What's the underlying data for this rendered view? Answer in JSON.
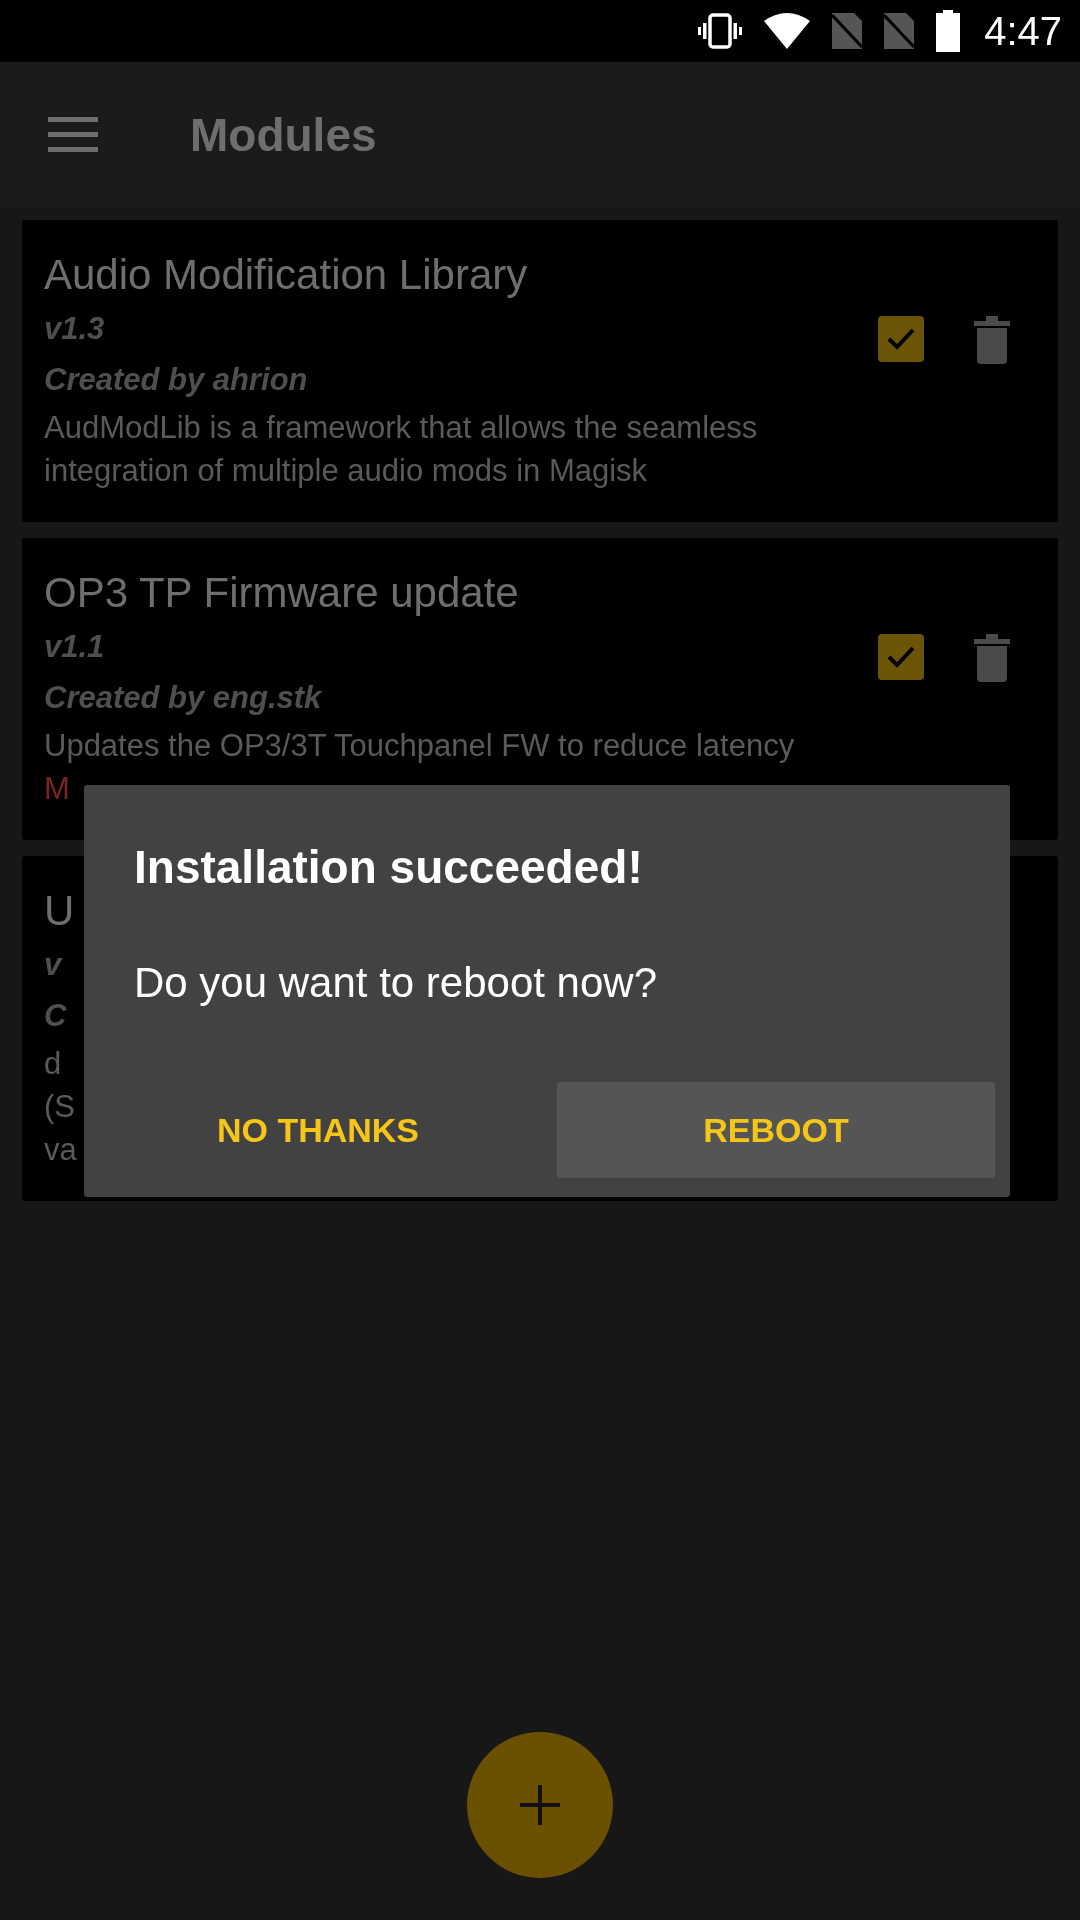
{
  "status_bar": {
    "time": "4:47"
  },
  "app_bar": {
    "title": "Modules"
  },
  "modules": [
    {
      "name": "Audio Modification Library",
      "version": "v1.3",
      "author": "Created by ahrion",
      "description": [
        "AudModLib is a framework that allows the seamless",
        "integration of multiple audio mods in Magisk"
      ],
      "enabled": true
    },
    {
      "name": "OP3 TP Firmware update",
      "version": "v1.1",
      "author": "Created by eng.stk",
      "description": [
        "Updates the OP3/3T Touchpanel FW to reduce latency"
      ],
      "notice": "M",
      "enabled": true
    },
    {
      "name": "U",
      "version": "v",
      "author": "C",
      "description": [
        "d",
        "(S",
        "va"
      ]
    }
  ],
  "dialog": {
    "title": "Installation succeeded!",
    "message": "Do you want to reboot now?",
    "buttons": [
      {
        "label": "NO THANKS",
        "focused": false
      },
      {
        "label": "REBOOT",
        "focused": true
      }
    ]
  }
}
